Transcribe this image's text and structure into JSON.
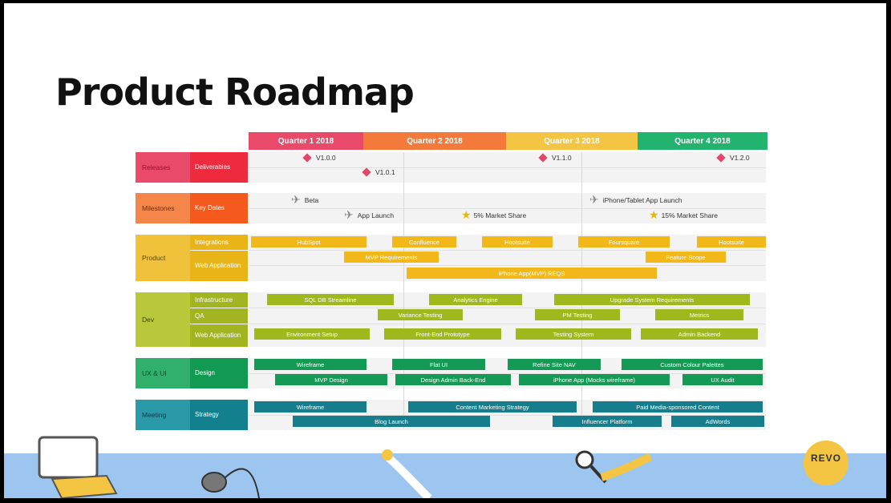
{
  "title": "Product Roadmap",
  "quarters": [
    {
      "label": "Quarter 1 2018",
      "color": "#ea4a6a"
    },
    {
      "label": "Quarter 2 2018",
      "color": "#f47a3c"
    },
    {
      "label": "Quarter 3 2018",
      "color": "#f4c542"
    },
    {
      "label": "Quarter 4 2018",
      "color": "#22b36f"
    }
  ],
  "categories": [
    {
      "label": "Releases",
      "sub": [
        "Deliverables"
      ],
      "color": "#ea4a6a",
      "subcolor": "#f02a3e"
    },
    {
      "label": "Milestones",
      "sub": [
        "Key Dates"
      ],
      "color": "#f5864a",
      "subcolor": "#f45a1e"
    },
    {
      "label": "Product",
      "sub": [
        "Integrations",
        "Web Application"
      ],
      "color": "#f0c23c",
      "subcolor": "#e8b418"
    },
    {
      "label": "Dev",
      "sub": [
        "Infrastructure",
        "QA",
        "Web Application"
      ],
      "color": "#b8c83a",
      "subcolor": "#a2b420"
    },
    {
      "label": "UX & UI",
      "sub": [
        "Design"
      ],
      "color": "#30b06a",
      "subcolor": "#139a52"
    },
    {
      "label": "Meeting",
      "sub": [
        "Strategy"
      ],
      "color": "#2a9aa8",
      "subcolor": "#13808e"
    }
  ],
  "releases": [
    "V1.0.0",
    "V1.0.1",
    "V1.1.0",
    "V1.2.0"
  ],
  "milestones": {
    "launches": [
      "Beta",
      "App Launch",
      "iPhone/Tablet App Launch"
    ],
    "shares": [
      "5% Market Share",
      "15% Market Share"
    ]
  },
  "product_bars": [
    "HubSpot",
    "Confluence",
    "Hootsuite",
    "Foursquare",
    "Hootsuite",
    "MVP Requirements",
    "Feature Scope",
    "iPhone App(MVP) REQS"
  ],
  "dev_bars": [
    "SQL DB Streamline",
    "Analytics Engine",
    "Upgrade System Requirements",
    "Variance Testing",
    "PM Testing",
    "Metrics",
    "Environment Setup",
    "Front-End Prototype",
    "Testing System",
    "Admin Backend"
  ],
  "ux_bars": [
    "Wireframe",
    "Flat UI",
    "Refine Site NAV",
    "Custom Colour Palettes",
    "MVP Design",
    "Design Admin Back-End",
    "iPhone App (Mocks wireframe)",
    "UX Audit"
  ],
  "meeting_bars": [
    "Wireframe",
    "Content Marketing Strategy",
    "Paid Media-sponsored Content",
    "Blog Launch",
    "Influencer Platform",
    "AdWords"
  ],
  "logo": "REVO",
  "colors": {
    "product_bar": "#f2b81a",
    "dev_bar": "#9fb81e",
    "ux_bar": "#159a56",
    "meeting_bar": "#167d8d"
  }
}
